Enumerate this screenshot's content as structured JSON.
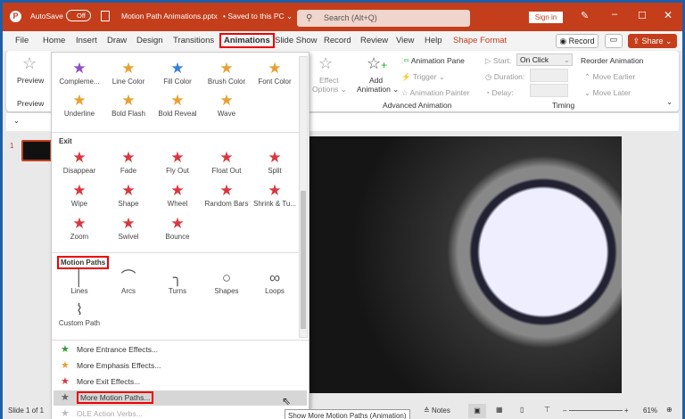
{
  "title": {
    "autosave": "AutoSave",
    "toggle": "Off",
    "filename": "Motion Path Animations.pptx",
    "saved": "• Saved to this PC ⌄",
    "search": "Search (Alt+Q)",
    "signin": "Sign in"
  },
  "tabs": [
    "File",
    "Home",
    "Insert",
    "Draw",
    "Design",
    "Transitions",
    "Animations",
    "Slide Show",
    "Record",
    "Review",
    "View",
    "Help",
    "Shape Format"
  ],
  "tab_buttons": {
    "record": "Record",
    "share": "Share"
  },
  "ribbon": {
    "preview": "Preview",
    "preview_group": "Preview",
    "effect": "Effect",
    "options": "Options ⌄",
    "add": "Add",
    "animation": "Animation ⌄",
    "pane": "Animation Pane",
    "trigger": "Trigger ⌄",
    "painter": "Animation Painter",
    "adv_group": "Advanced Animation",
    "start": "Start:",
    "start_val": "On Click",
    "duration": "Duration:",
    "delay": "Delay:",
    "timing_group": "Timing",
    "reorder": "Reorder Animation",
    "earlier": "Move Earlier",
    "later": "Move Later"
  },
  "gallery": {
    "emphasis": [
      {
        "l": "Compleme...",
        "c": "#8a4fc7"
      },
      {
        "l": "Line Color",
        "c": "#e8a030"
      },
      {
        "l": "Fill Color",
        "c": "#3b7fd4"
      },
      {
        "l": "Brush Color",
        "c": "#e8a030"
      },
      {
        "l": "Font Color",
        "c": "#e8a030"
      },
      {
        "l": "Underline",
        "c": "#e8a030"
      },
      {
        "l": "Bold Flash",
        "c": "#e8a030"
      },
      {
        "l": "Bold Reveal",
        "c": "#e8a030"
      },
      {
        "l": "Wave",
        "c": "#e8a030"
      }
    ],
    "exit_header": "Exit",
    "exit": [
      "Disappear",
      "Fade",
      "Fly Out",
      "Float Out",
      "Split",
      "Wipe",
      "Shape",
      "Wheel",
      "Random Bars",
      "Shrink & Tu...",
      "Zoom",
      "Swivel",
      "Bounce"
    ],
    "motion_header": "Motion Paths",
    "motion": [
      {
        "l": "Lines",
        "i": "│"
      },
      {
        "l": "Arcs",
        "i": "⌒"
      },
      {
        "l": "Turns",
        "i": "╮"
      },
      {
        "l": "Shapes",
        "i": "○"
      },
      {
        "l": "Loops",
        "i": "∞"
      },
      {
        "l": "Custom Path",
        "i": "⌇"
      }
    ],
    "menu": [
      {
        "l": "More Entrance Effects...",
        "c": "#3a9a3a"
      },
      {
        "l": "More Emphasis Effects...",
        "c": "#e8a030"
      },
      {
        "l": "More Exit Effects...",
        "c": "#d9363e"
      },
      {
        "l": "More Motion Paths...",
        "c": "#666"
      },
      {
        "l": "OLE Action Verbs...",
        "c": "#bbb"
      }
    ]
  },
  "tooltip": "Show More Motion Paths (Animation)",
  "status": {
    "slide": "Slide 1 of 1",
    "notes": "Notes",
    "zoom": "61%"
  },
  "thumb_num": "1"
}
